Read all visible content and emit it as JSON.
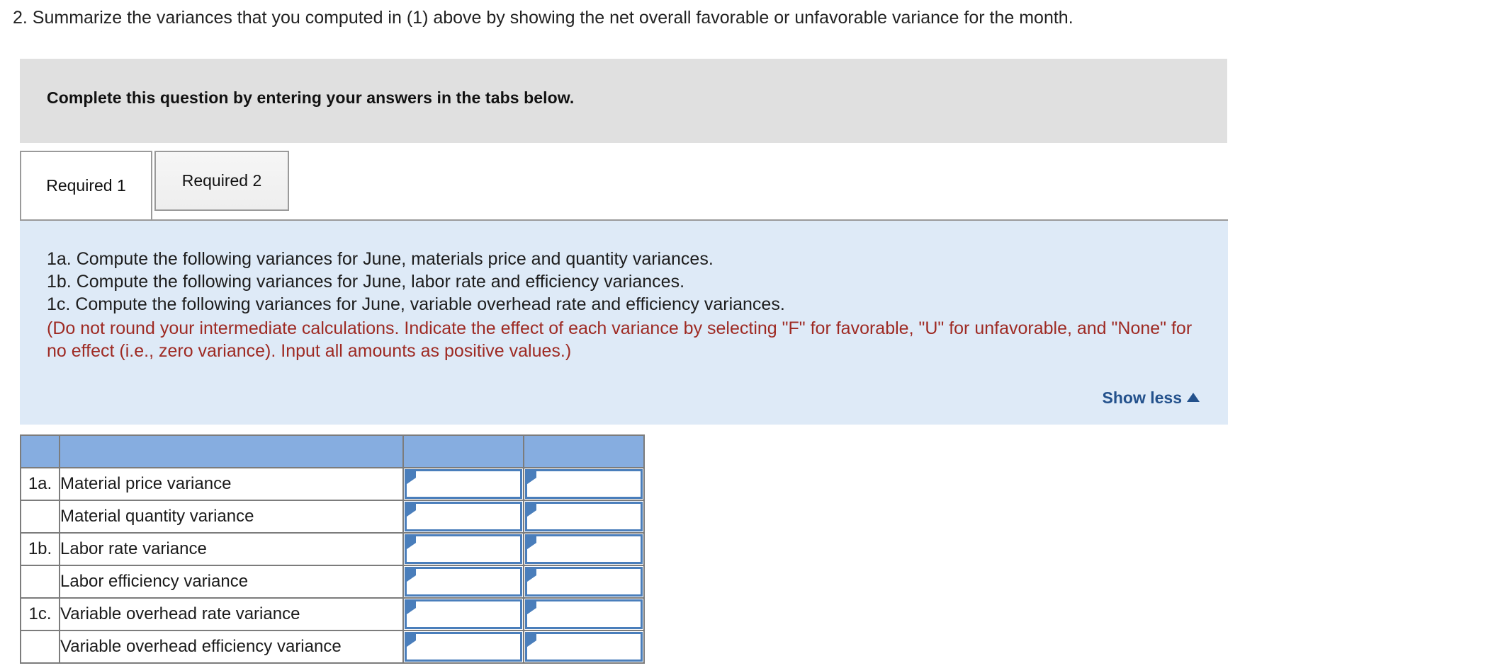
{
  "question": {
    "text": "2. Summarize the variances that you computed in (1) above by showing the net overall favorable or unfavorable variance for the month."
  },
  "banner": {
    "text": "Complete this question by entering your answers in the tabs below."
  },
  "tabs": [
    {
      "label": "Required 1",
      "active": true
    },
    {
      "label": "Required 2",
      "active": false
    }
  ],
  "instructions": {
    "lines": [
      "1a. Compute the following variances for June, materials price and quantity variances.",
      "1b. Compute the following variances for June, labor rate and efficiency variances.",
      "1c. Compute the following variances for June, variable overhead rate and efficiency variances."
    ],
    "note": "(Do not round your intermediate calculations. Indicate the effect of each variance by selecting \"F\" for favorable, \"U\" for unfavorable, and \"None\" for no effect (i.e., zero variance). Input all amounts as positive values.)",
    "note_color": "#9e2a23",
    "show_less_label": "Show less",
    "show_less_icon": "triangle-up-icon",
    "link_color": "#23518c"
  },
  "answer_table": {
    "header": {
      "num": "",
      "label": "",
      "amount": "",
      "effect": ""
    },
    "header_color": "#86ade0",
    "input_border_color": "#4a7ebb",
    "rows": [
      {
        "num": "1a.",
        "label": "Material price variance",
        "amount": "",
        "effect": ""
      },
      {
        "num": "",
        "label": "Material quantity variance",
        "amount": "",
        "effect": ""
      },
      {
        "num": "1b.",
        "label": "Labor rate variance",
        "amount": "",
        "effect": ""
      },
      {
        "num": "",
        "label": "Labor efficiency variance",
        "amount": "",
        "effect": ""
      },
      {
        "num": "1c.",
        "label": "Variable overhead rate variance",
        "amount": "",
        "effect": ""
      },
      {
        "num": "",
        "label": "Variable overhead efficiency variance",
        "amount": "",
        "effect": ""
      }
    ]
  }
}
